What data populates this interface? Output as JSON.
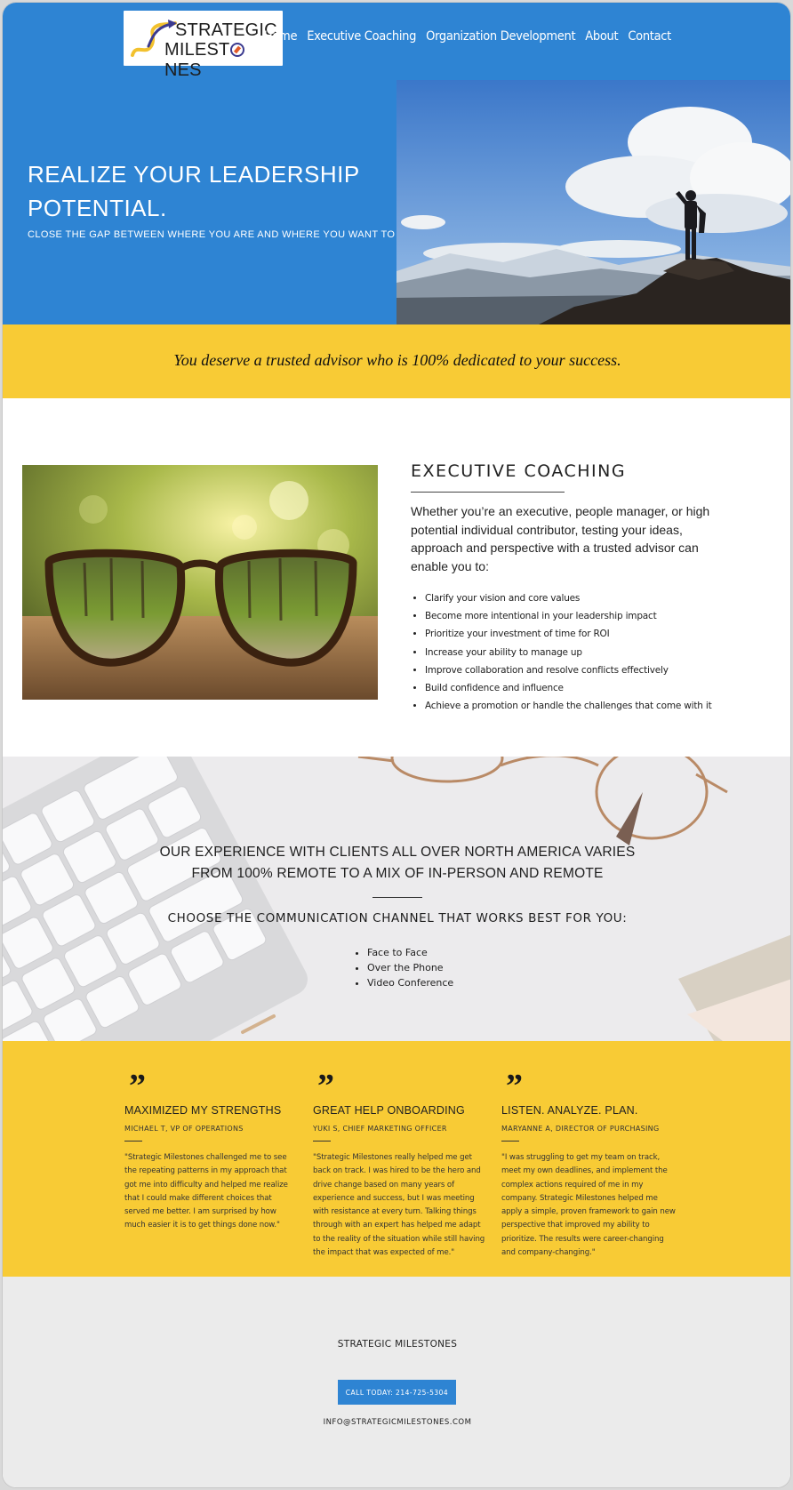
{
  "brand": {
    "logo_line1": "STRATEGIC",
    "logo_line2": "MILEST NES",
    "logo_alt": "Strategic Milestones logo",
    "blue": "#2e84d3",
    "yellow": "#f8cb35"
  },
  "nav": {
    "items": [
      "Home",
      "Executive Coaching",
      "Organization Development",
      "About",
      "Contact"
    ]
  },
  "hero": {
    "title": "REALIZE YOUR LEADERSHIP POTENTIAL.",
    "subtitle": "CLOSE THE GAP BETWEEN WHERE YOU ARE AND WHERE YOU WANT TO BE",
    "image": "person-on-mountain-photo"
  },
  "tagline": "You deserve a trusted advisor who is 100% dedicated to your success.",
  "coaching": {
    "title": "EXECUTIVE COACHING",
    "image": "eyeglasses-photo",
    "intro": "Whether you’re an executive, people manager, or high potential individual contributor, testing your ideas, approach and perspective with a trusted advisor can enable you to:",
    "bullets": [
      "Clarify your vision and core values",
      "Become more intentional in your leadership impact",
      "Prioritize your investment of time for ROI",
      "Increase your ability to manage up",
      "Improve collaboration and resolve conflicts effectively",
      "Build confidence and influence",
      "Achieve a promotion or handle the challenges that come with it"
    ]
  },
  "experience": {
    "title_line1": "OUR EXPERIENCE WITH CLIENTS ALL OVER NORTH AMERICA VARIES",
    "title_line2": "FROM 100% REMOTE TO A MIX OF IN-PERSON AND REMOTE",
    "subtitle": "CHOOSE THE COMMUNICATION CHANNEL THAT WORKS BEST FOR YOU:",
    "channels": [
      "Face to Face",
      "Over the Phone",
      "Video Conference"
    ],
    "image": "keyboard-and-glasses-background"
  },
  "testimonials": [
    {
      "title": "MAXIMIZED MY STRENGTHS",
      "author": "MICHAEL T, VP OF OPERATIONS",
      "text": "\"Strategic Milestones challenged me to see the repeating patterns in my approach that got me into difficulty and helped me realize that I could make different choices that served me better. I am surprised by how much easier it is to get things done now.\""
    },
    {
      "title": "GREAT HELP ONBOARDING",
      "author": "YUKI S, CHIEF MARKETING OFFICER",
      "text": "\"Strategic Milestones really helped me get back on track. I was hired to be the hero and drive change based on many years of experience and success, but I was meeting with resistance at every turn. Talking things through with an expert has helped me adapt to the reality of the situation while still having the impact that was expected of me.\""
    },
    {
      "title": "LISTEN. ANALYZE. PLAN.",
      "author": "MARYANNE A, DIRECTOR OF PURCHASING",
      "text": "\"I was struggling to get my team on track, meet my own deadlines, and implement the complex actions required of me in my company. Strategic Milestones helped me apply a simple, proven framework to gain new perspective that improved my ability to prioritize. The results were career-changing and company-changing.\""
    }
  ],
  "quote_glyph": "”",
  "footer": {
    "name": "STRATEGIC MILESTONES",
    "cta": "CALL TODAY: 214-725-5304",
    "email": "INFO@STRATEGICMILESTONES.COM"
  }
}
